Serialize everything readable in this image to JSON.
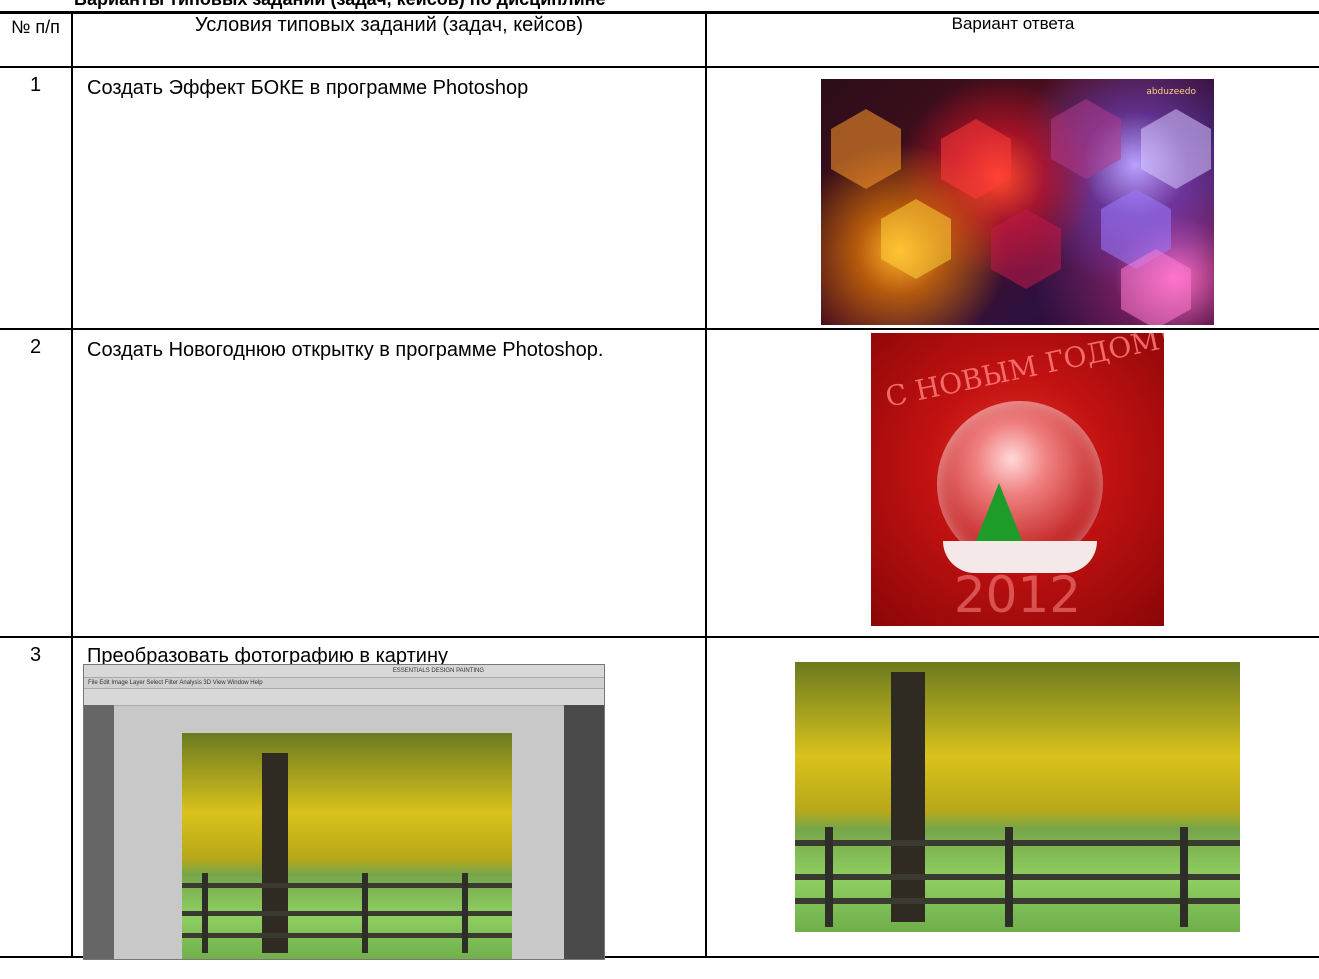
{
  "page": {
    "title": "Варианты типовых заданий (задач, кейсов) по дисциплине"
  },
  "table": {
    "headers": {
      "num": "№ п/п",
      "condition": "Условия типовых заданий (задач, кейсов)",
      "answer": "Вариант ответа"
    },
    "rows": [
      {
        "num": "1",
        "condition": "Создать Эффект БОКЕ в программе Photoshop"
      },
      {
        "num": "2",
        "condition": "Создать Новогоднюю открытку в программе Photoshop."
      },
      {
        "num": "3",
        "condition": "Преобразовать фотографию в картину"
      }
    ]
  },
  "images": {
    "bokeh_logo": "abduzeedo",
    "card_greeting": "С НОВЫМ ГОДОМ!!",
    "card_year": "2012",
    "ps_menu": "File  Edit  Image  Layer  Select  Filter  Analysis  3D  View  Window  Help",
    "ps_tabs": "ESSENTIALS   DESIGN   PAINTING"
  }
}
